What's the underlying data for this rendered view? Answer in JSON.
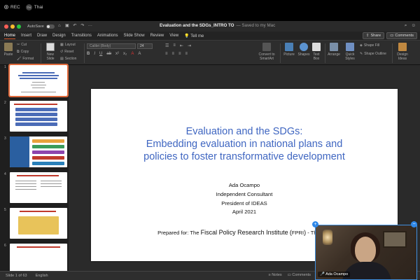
{
  "overlay": {
    "rec_label": "REC",
    "thai_label": "Thai",
    "thai_badge": "TH"
  },
  "window": {
    "autosave_label": "AutoSave",
    "title_file": "Evaluation and the SDGs_INTRO TO",
    "title_saved": "— Saved to my Mac",
    "tabs": [
      "Home",
      "Insert",
      "Draw",
      "Design",
      "Transitions",
      "Animations",
      "Slide Show",
      "Review",
      "View",
      "Tell me"
    ],
    "share_label": "Share",
    "comments_label": "Comments"
  },
  "ribbon": {
    "paste": "Paste",
    "cut": "Cut",
    "copy": "Copy",
    "format": "Format",
    "new_slide": "New Slide",
    "layout": "Layout",
    "reset": "Reset",
    "section": "Section",
    "font_name": "Calibri (Body)",
    "font_size": "24",
    "convert": "Convert to SmartArt",
    "picture": "Picture",
    "shapes": "Shapes",
    "text_box": "Text Box",
    "arrange": "Arrange",
    "quick_styles": "Quick Styles",
    "shape_fill": "Shape Fill",
    "shape_outline": "Shape Outline",
    "design_ideas": "Design Ideas"
  },
  "slides": [
    {
      "num": "1"
    },
    {
      "num": "2"
    },
    {
      "num": "3"
    },
    {
      "num": "4"
    },
    {
      "num": "5"
    },
    {
      "num": "6"
    }
  ],
  "slide": {
    "title_lines": [
      "Evaluation and the SDGs:",
      "Embedding evaluation in national plans and",
      "policies to foster transformative development"
    ],
    "author": "Ada Ocampo",
    "role1": "Independent Consultant",
    "role2": "President of IDEAS",
    "date": "April 2021",
    "prepared_prefix": "Prepared for: The",
    "prepared_inst": "Fiscal Policy Research Institute",
    "prepared_paren_open": "(",
    "prepared_acronym": "FPRI",
    "prepared_paren_close": ")",
    "prepared_suffix": " - Thailand"
  },
  "status": {
    "slide_counter": "Slide 1 of 63",
    "language": "English",
    "notes": "Notes",
    "comments": "Comments"
  },
  "video": {
    "participant_name": "Ada Ocampo"
  }
}
